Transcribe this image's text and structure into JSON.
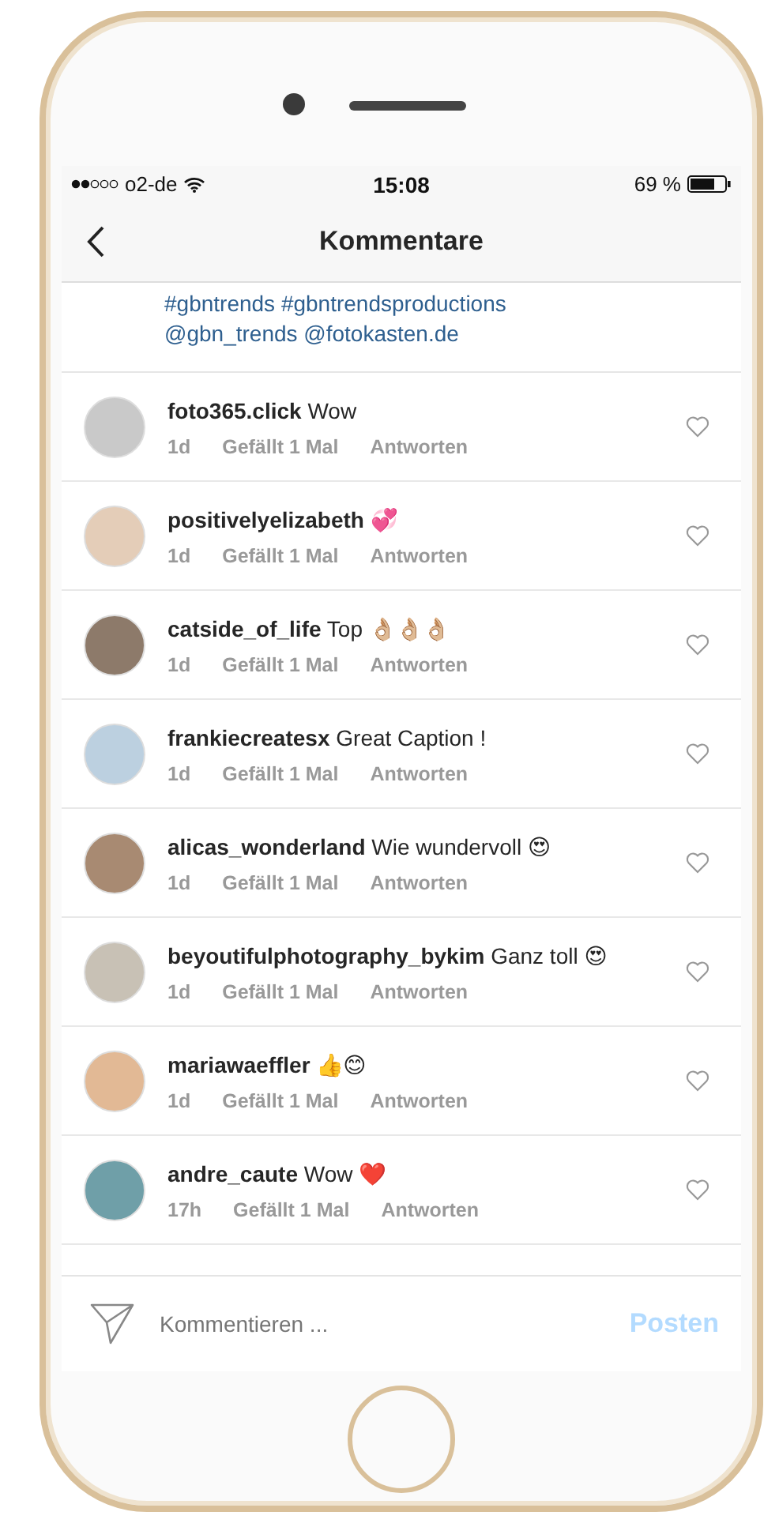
{
  "status_bar": {
    "carrier": "o2-de",
    "time": "15:08",
    "battery": "69 %"
  },
  "header": {
    "title": "Kommentare"
  },
  "caption": {
    "lines": [
      "#gbntrends #gbntrendsproductions",
      "@gbn_trends @fotokasten.de"
    ]
  },
  "comments": [
    {
      "user": "foto365.click",
      "text": "Wow",
      "age": "1d",
      "likes": "Gefällt 1 Mal",
      "reply": "Antworten",
      "liked": false
    },
    {
      "user": "positivelyelizabeth",
      "text": "💞",
      "age": "1d",
      "likes": "Gefällt 1 Mal",
      "reply": "Antworten",
      "liked": false
    },
    {
      "user": "catside_of_life",
      "text": "Top 👌🏼👌🏼👌🏼",
      "age": "1d",
      "likes": "Gefällt 1 Mal",
      "reply": "Antworten",
      "liked": false
    },
    {
      "user": "frankiecreatesx",
      "text": "Great Caption !",
      "age": "1d",
      "likes": "Gefällt 1 Mal",
      "reply": "Antworten",
      "liked": false
    },
    {
      "user": "alicas_wonderland",
      "text": "Wie wundervoll 😍",
      "age": "1d",
      "likes": "Gefällt 1 Mal",
      "reply": "Antworten",
      "liked": false
    },
    {
      "user": "beyoutifulphotography_bykim",
      "text": "Ganz toll 😍",
      "age": "1d",
      "likes": "Gefällt 1 Mal",
      "reply": "Antworten",
      "liked": false
    },
    {
      "user": "mariawaeffler",
      "text": "👍😊",
      "age": "1d",
      "likes": "Gefällt 1 Mal",
      "reply": "Antworten",
      "liked": false
    },
    {
      "user": "andre_caute",
      "text": "Wow ❤️",
      "age": "17h",
      "likes": "Gefällt 1 Mal",
      "reply": "Antworten",
      "liked": false
    }
  ],
  "composer": {
    "placeholder": "Kommentieren ...",
    "post_button": "Posten"
  }
}
